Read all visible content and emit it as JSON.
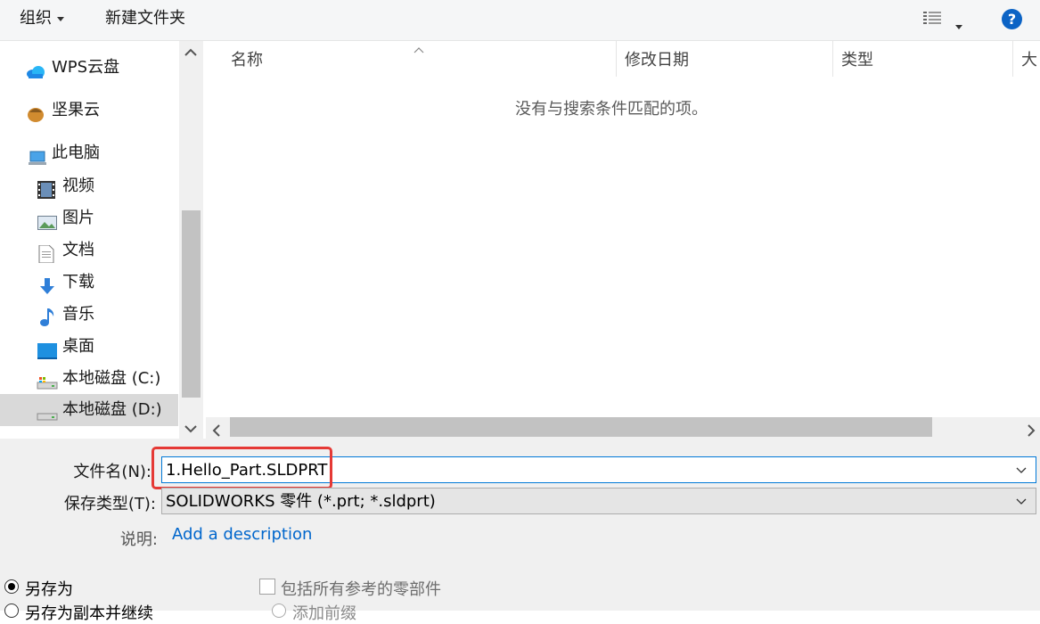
{
  "toolbar": {
    "organize_label": "组织",
    "new_folder_label": "新建文件夹"
  },
  "nav": {
    "items": [
      {
        "label": "WPS云盘",
        "icon": "cloud-icon"
      },
      {
        "label": "坚果云",
        "icon": "nut-icon"
      },
      {
        "label": "此电脑",
        "icon": "computer-icon"
      },
      {
        "label": "视频",
        "icon": "video-icon"
      },
      {
        "label": "图片",
        "icon": "picture-icon"
      },
      {
        "label": "文档",
        "icon": "document-icon"
      },
      {
        "label": "下载",
        "icon": "download-icon"
      },
      {
        "label": "音乐",
        "icon": "music-icon"
      },
      {
        "label": "桌面",
        "icon": "desktop-icon"
      },
      {
        "label": "本地磁盘 (C:)",
        "icon": "drive-icon"
      },
      {
        "label": "本地磁盘 (D:)",
        "icon": "drive-icon",
        "selected": true
      }
    ]
  },
  "list": {
    "columns": [
      "名称",
      "修改日期",
      "类型",
      "大小"
    ],
    "empty_text": "没有与搜索条件匹配的项。"
  },
  "form": {
    "filename_label": "文件名(N):",
    "filename_value": "1.Hello_Part.SLDPRT",
    "filetype_label": "保存类型(T):",
    "filetype_value": "SOLIDWORKS 零件 (*.prt; *.sldprt)",
    "description_label": "说明:",
    "description_link": "Add a description"
  },
  "options": {
    "save_as_label": "另存为",
    "save_as_copy_continue_label": "另存为副本并继续",
    "include_refs_label": "包括所有参考的零部件",
    "add_prefix_label": "添加前缀"
  },
  "colors": {
    "accent": "#0078d7",
    "highlight": "#e53935",
    "link": "#0066cc"
  }
}
